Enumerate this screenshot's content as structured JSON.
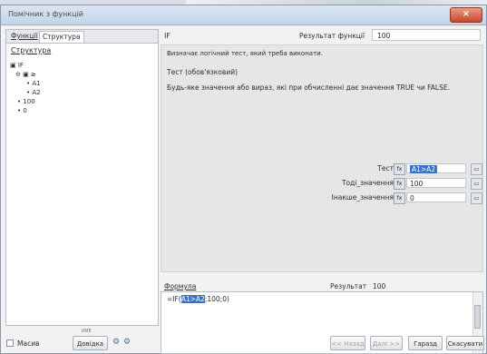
{
  "window": {
    "title": "Помічник з функцій",
    "close_glyph": "×"
  },
  "left_panel": {
    "tabs": [
      "Функції",
      "Структура"
    ],
    "structure_label": "Структура",
    "tree": [
      {
        "label": "▣ IF",
        "indent": 0
      },
      {
        "label": "⊖ ▣ ≥",
        "indent": 6
      },
      {
        "label": "• A1",
        "indent": 18
      },
      {
        "label": "• A2",
        "indent": 18
      },
      {
        "label": "• 100",
        "indent": 8
      },
      {
        "label": "• 0",
        "indent": 8
      }
    ]
  },
  "function": {
    "name": "IF",
    "result_label": "Результат функції",
    "result_value": "100",
    "description": "Визначає логічний тест, який треба виконати.",
    "param_title": "Тест (обов'язковий)",
    "param_description": "Будь-яке значення або вираз, які при обчисленні дає значення TRUE чи FALSE."
  },
  "params": [
    {
      "label": "Тест",
      "value": "A1>A2",
      "selected": true
    },
    {
      "label": "Тоді_значення",
      "value": "100",
      "selected": false
    },
    {
      "label": "Інакше_значення",
      "value": "0",
      "selected": false
    }
  ],
  "icons": {
    "fx": "fx-icon",
    "collapse": "shrink-icon"
  },
  "formula": {
    "label": "Формула",
    "prefix": "=IF(",
    "highlight": "A1>A2",
    "suffix": ";100;0)",
    "result_label": "Результат",
    "result_value": "100"
  },
  "bottom": {
    "checkbox_label": "Масив",
    "help": "Довідка",
    "tiny_label": "ИИЕ",
    "back": "<< Назад",
    "next": "Далі >>",
    "ok": "Гаразд",
    "cancel": "Скасувати"
  }
}
